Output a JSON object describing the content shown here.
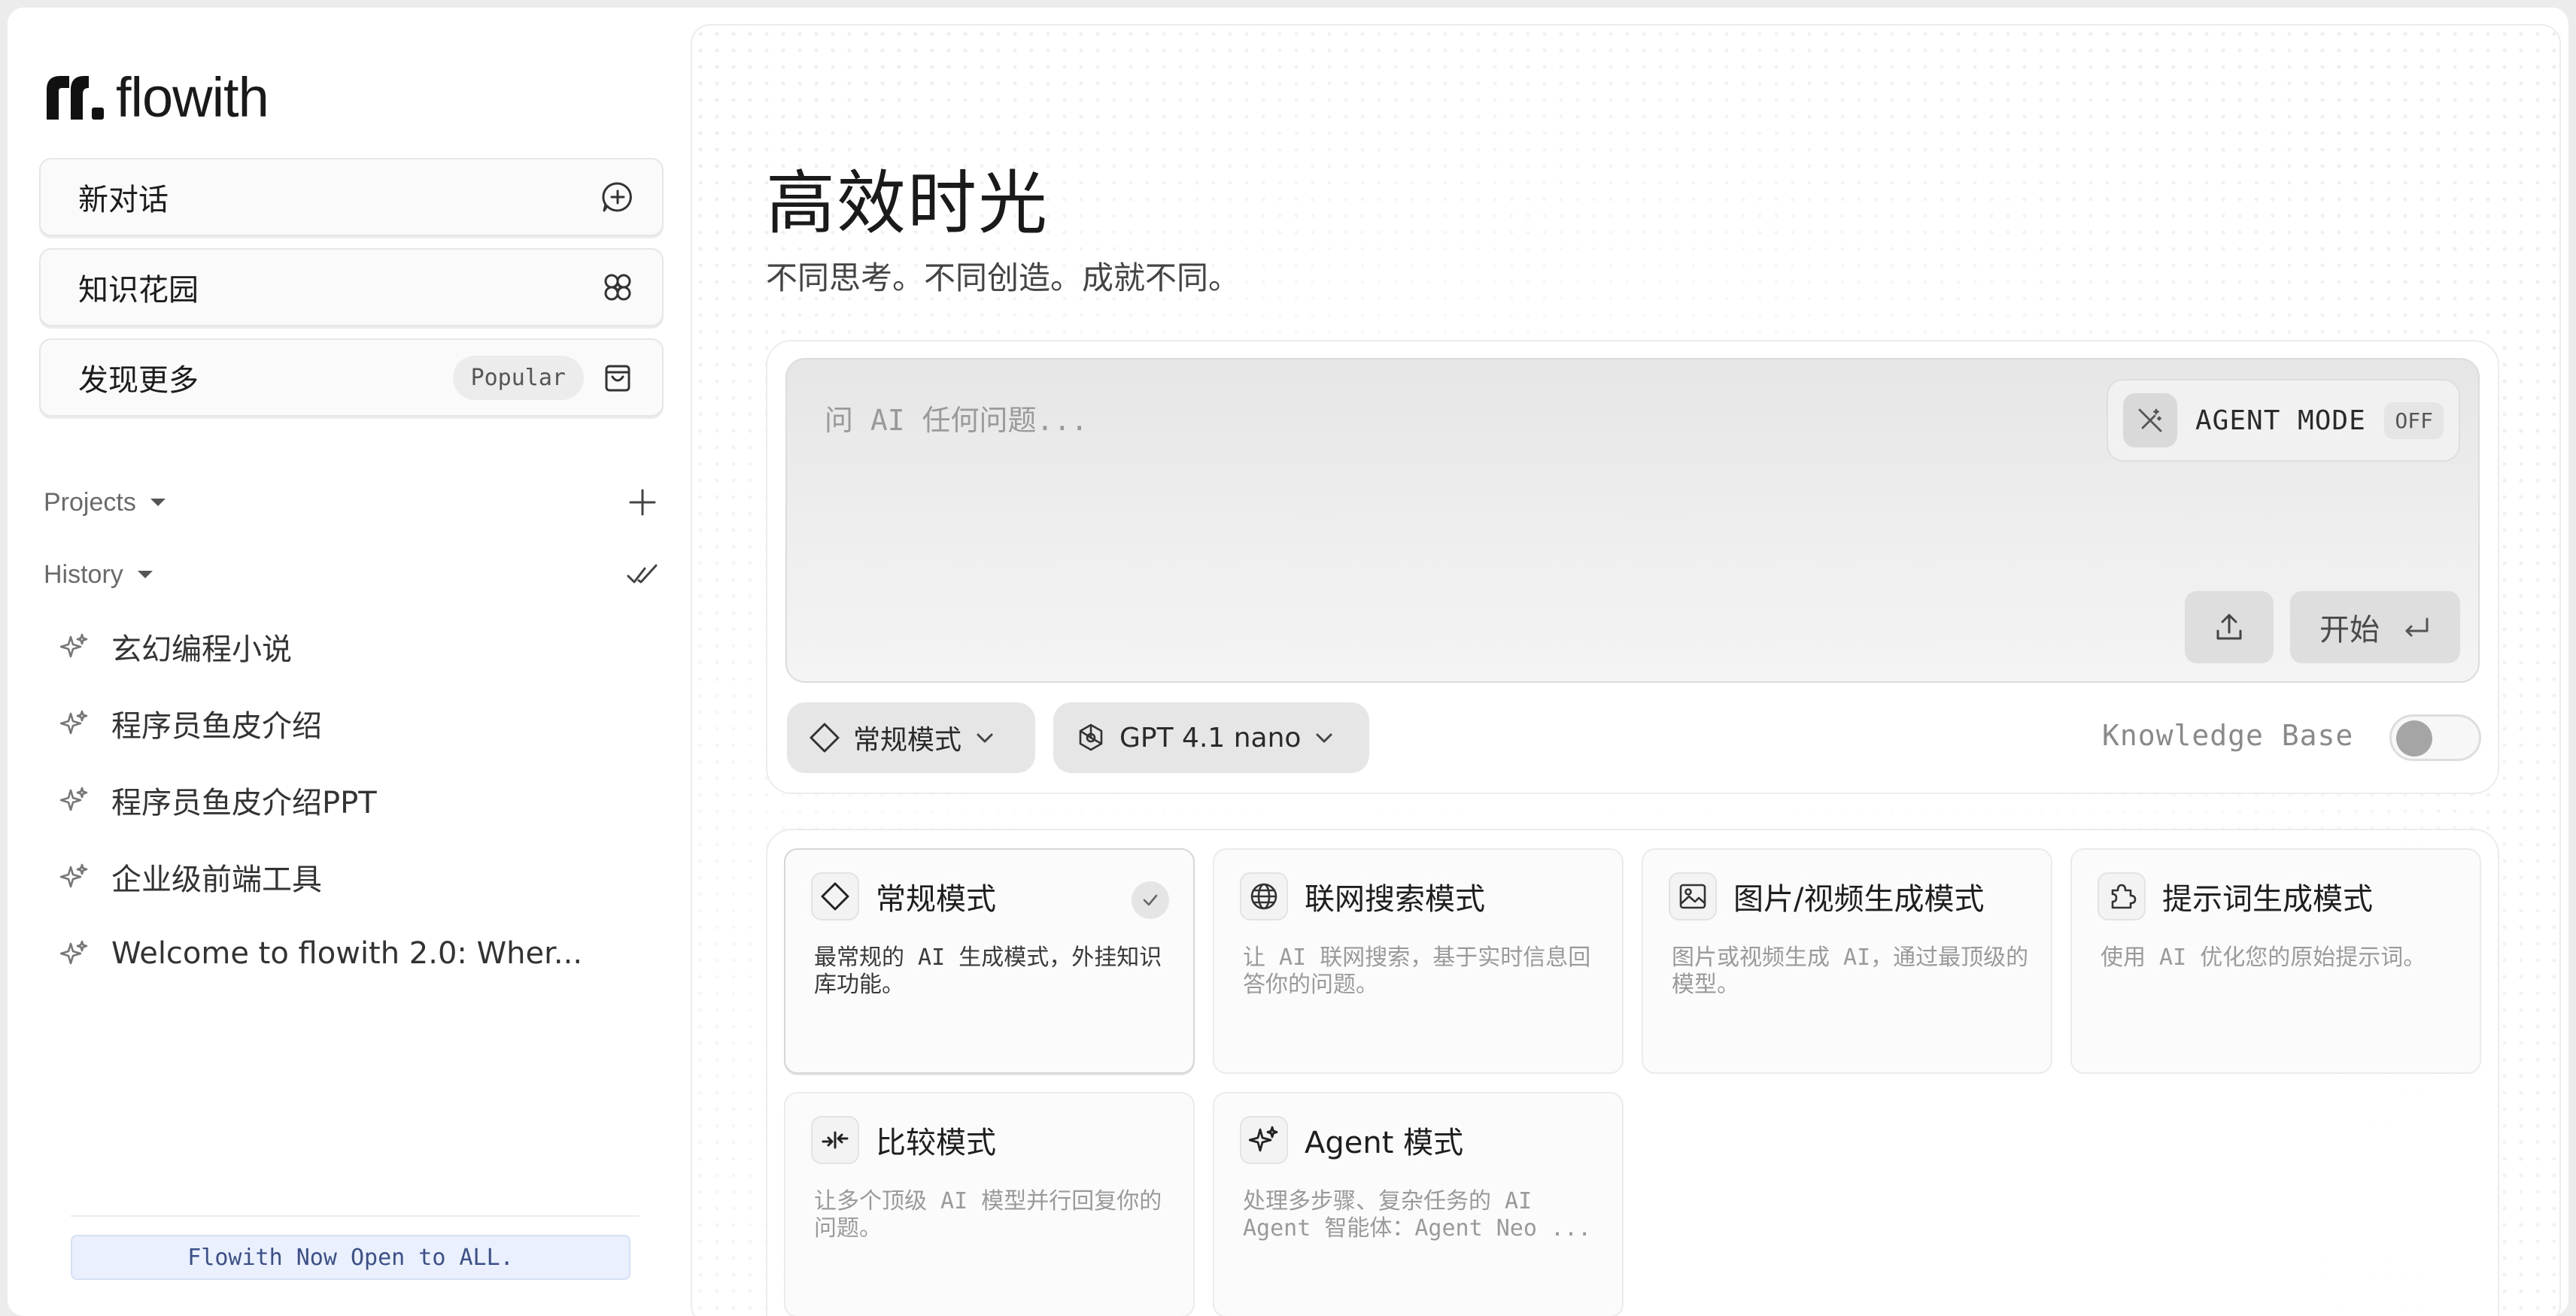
{
  "app": {
    "logo_text": "flowith"
  },
  "sidebar": {
    "nav": [
      {
        "label": "新对话",
        "icon": "chat-plus-icon"
      },
      {
        "label": "知识花园",
        "icon": "flower-icon"
      },
      {
        "label": "发现更多",
        "badge": "Popular",
        "icon": "shopping-bag-icon"
      }
    ],
    "projects_label": "Projects",
    "history_label": "History",
    "history": [
      "玄幻编程小说",
      "程序员鱼皮介绍",
      "程序员鱼皮介绍PPT",
      "企业级前端工具",
      "Welcome to flowith 2.0: Wher..."
    ],
    "announcement": "Flowith Now Open to ALL."
  },
  "main": {
    "title": "高效时光",
    "subtitle": "不同思考。不同创造。成就不同。",
    "composer": {
      "placeholder": "问 AI 任何问题...",
      "agent_mode_label": "AGENT MODE",
      "agent_mode_state": "OFF",
      "start_label": "开始"
    },
    "mode_chip": "常规模式",
    "model_chip": "GPT 4.1 nano",
    "knowledge_base_label": "Knowledge Base",
    "knowledge_base_on": false,
    "modes": [
      {
        "title": "常规模式",
        "desc": "最常规的 AI 生成模式，外挂知识库功能。",
        "icon": "diamond-icon",
        "selected": true
      },
      {
        "title": "联网搜索模式",
        "desc": "让 AI 联网搜索，基于实时信息回答你的问题。",
        "icon": "globe-icon",
        "selected": false
      },
      {
        "title": "图片/视频生成模式",
        "desc": "图片或视频生成 AI，通过最顶级的模型。",
        "icon": "image-icon",
        "selected": false
      },
      {
        "title": "提示词生成模式",
        "desc": "使用 AI 优化您的原始提示词。",
        "icon": "puzzle-icon",
        "selected": false
      },
      {
        "title": "比较模式",
        "desc": "让多个顶级 AI 模型并行回复你的问题。",
        "icon": "compare-icon",
        "selected": false
      },
      {
        "title": "Agent 模式",
        "desc": "处理多步骤、复杂任务的 AI Agent 智能体：Agent Neo ...",
        "icon": "sparkles-icon",
        "selected": false
      }
    ]
  }
}
